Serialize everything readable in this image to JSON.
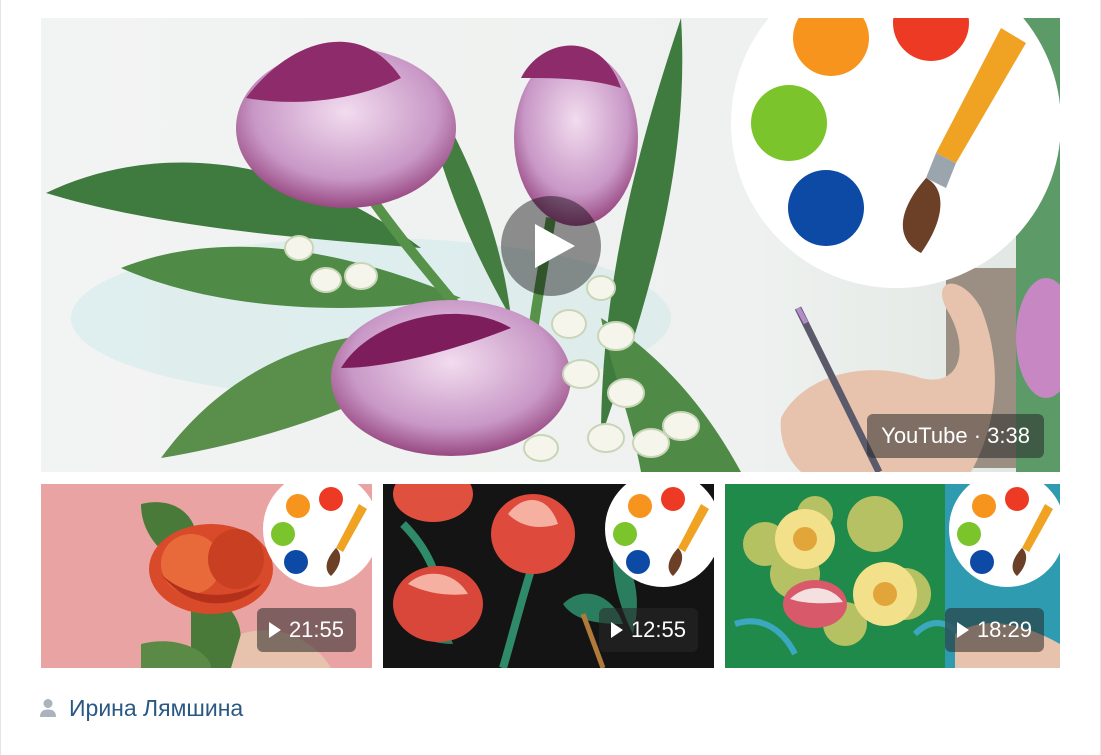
{
  "main_video": {
    "badge": "YouTube · 3:38"
  },
  "videos": [
    {
      "duration": "21:55"
    },
    {
      "duration": "12:55"
    },
    {
      "duration": "18:29"
    }
  ],
  "author": {
    "name": "Ирина Лямшина"
  },
  "colors": {
    "link": "#2a5885",
    "palette_orange": "#f7941d",
    "palette_red": "#ed3a24",
    "palette_green": "#7cc42c",
    "palette_blue": "#0c4aa6"
  },
  "icons": [
    "play-icon",
    "palette-logo-icon",
    "person-icon"
  ]
}
